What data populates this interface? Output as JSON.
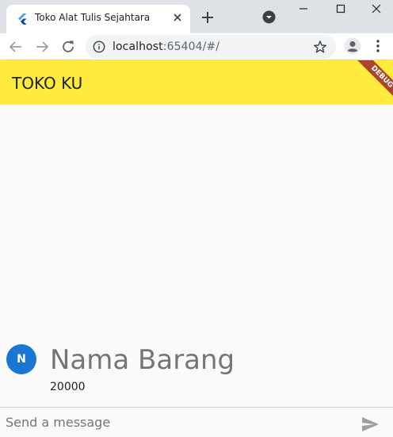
{
  "browser": {
    "tab_title": "Toko Alat Tulis Sejahtara",
    "url_host": "localhost",
    "url_rest": ":65404/#/"
  },
  "app": {
    "title": "TOKO KU",
    "debug_label": "DEBUG",
    "appbar_color": "#ffeb3b"
  },
  "messages": [
    {
      "avatar_initial": "N",
      "name": "Nama Barang",
      "text": "20000",
      "avatar_color": "#1976d2"
    }
  ],
  "composer": {
    "placeholder": "Send a message",
    "send_icon": "send-icon"
  }
}
